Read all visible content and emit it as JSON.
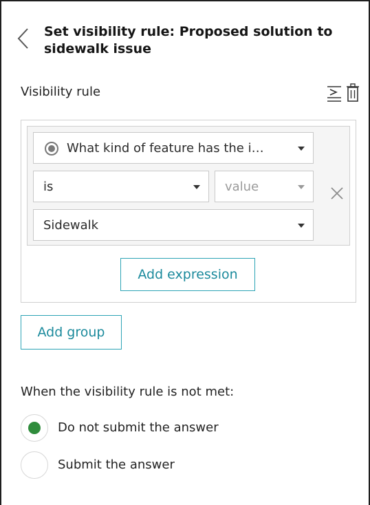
{
  "header": {
    "back_icon": "chevron-left-icon",
    "title": "Set visibility rule: Proposed solution to sidewalk issue"
  },
  "visibility_rule": {
    "label": "Visibility rule",
    "actions": [
      {
        "name": "collapse-expressions-icon"
      },
      {
        "name": "trash-icon"
      }
    ]
  },
  "rule": {
    "question_select": {
      "value": "What kind of feature has the i…"
    },
    "operator_select": {
      "value": "is"
    },
    "value_type_select": {
      "value": "value",
      "disabled": true
    },
    "answer_select": {
      "value": "Sidewalk"
    },
    "remove_icon": "close-icon",
    "add_expression_label": "Add expression"
  },
  "add_group_label": "Add group",
  "not_met": {
    "label": "When the visibility rule is not met:",
    "options": [
      {
        "label": "Do not submit the answer",
        "checked": true
      },
      {
        "label": "Submit the answer",
        "checked": false
      }
    ]
  },
  "colors": {
    "accent": "#2ba3b5",
    "accent_text": "#1b8a9c",
    "radio_checked": "#2f8c3c",
    "border": "#cfcfcf",
    "group_bg": "#f5f5f5"
  }
}
